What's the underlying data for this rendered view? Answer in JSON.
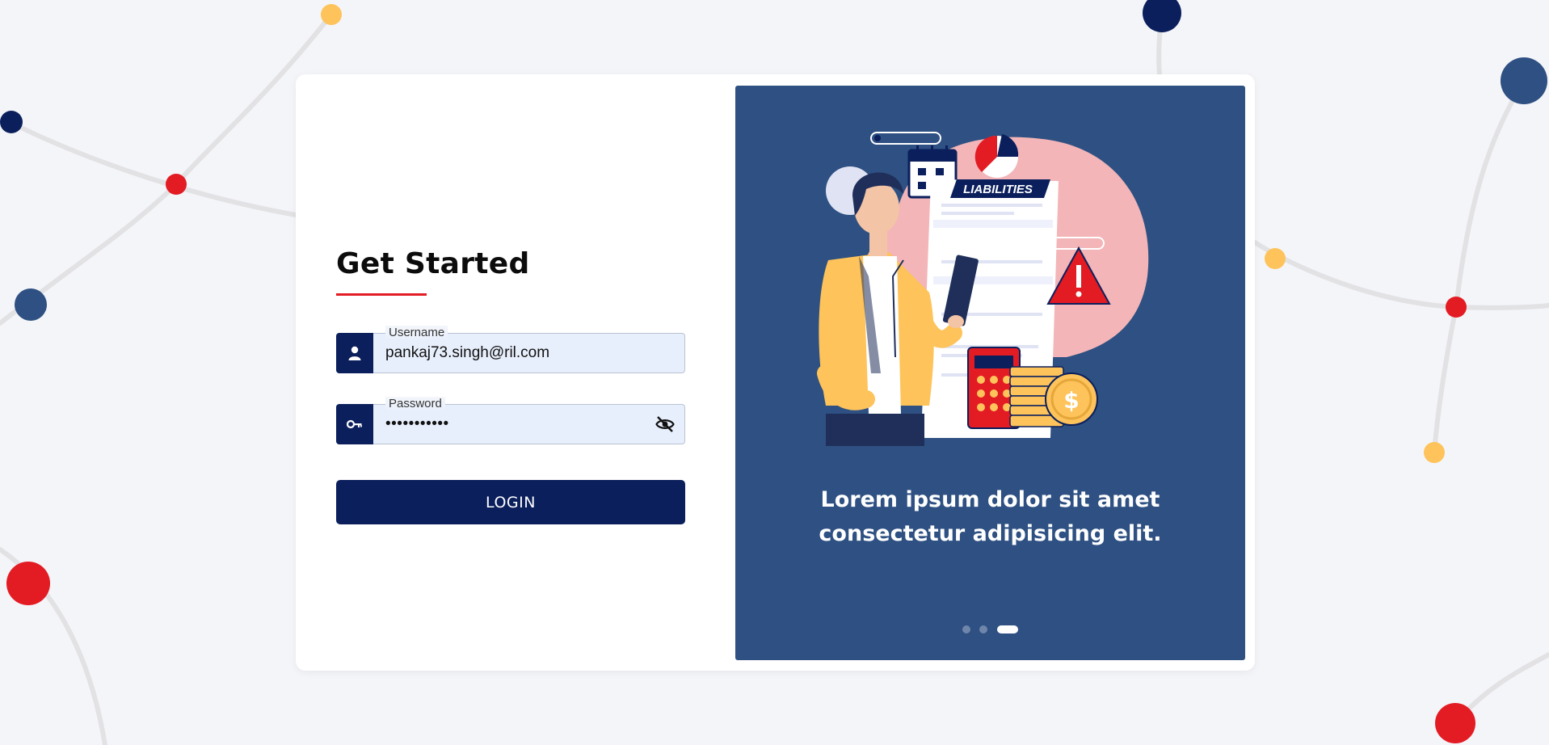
{
  "colors": {
    "brand_navy": "#0b1f5c",
    "accent_red": "#e31b23",
    "accent_yellow": "#fec35a",
    "panel_blue": "#2e5082",
    "page_background": "#f4f5f9"
  },
  "form": {
    "title": "Get Started",
    "username": {
      "label": "Username",
      "value": "pankaj73.singh@ril.com",
      "icon": "user-icon"
    },
    "password": {
      "label": "Password",
      "masked_value": "•••••••••••",
      "icon": "key-icon",
      "toggle_icon": "eye-slash-icon"
    },
    "login_label": "LOGIN"
  },
  "carousel": {
    "illustration_text": "LIABILITIES",
    "caption": "Lorem ipsum dolor sit amet consectetur adipisicing elit.",
    "slide_count": 3,
    "active_slide": 3
  }
}
